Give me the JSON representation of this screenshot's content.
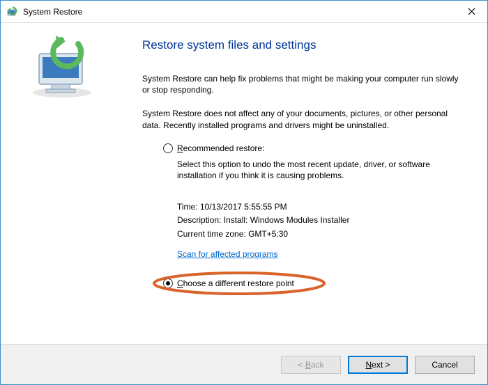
{
  "titlebar": {
    "title": "System Restore"
  },
  "main": {
    "heading": "Restore system files and settings",
    "para1": "System Restore can help fix problems that might be making your computer run slowly or stop responding.",
    "para2": "System Restore does not affect any of your documents, pictures, or other personal data. Recently installed programs and drivers might be uninstalled.",
    "recommended": {
      "label": "Recommended restore:",
      "desc": "Select this option to undo the most recent update, driver, or software installation if you think it is causing problems.",
      "time_label": "Time:",
      "time_value": "10/13/2017 5:55:55 PM",
      "desc_label": "Description:",
      "desc_value": "Install: Windows Modules Installer",
      "tz_label": "Current time zone:",
      "tz_value": "GMT+5:30",
      "scan_link": "Scan for affected programs"
    },
    "choose": {
      "label": "Choose a different restore point"
    }
  },
  "footer": {
    "back": "< Back",
    "next": "Next >",
    "cancel": "Cancel"
  }
}
